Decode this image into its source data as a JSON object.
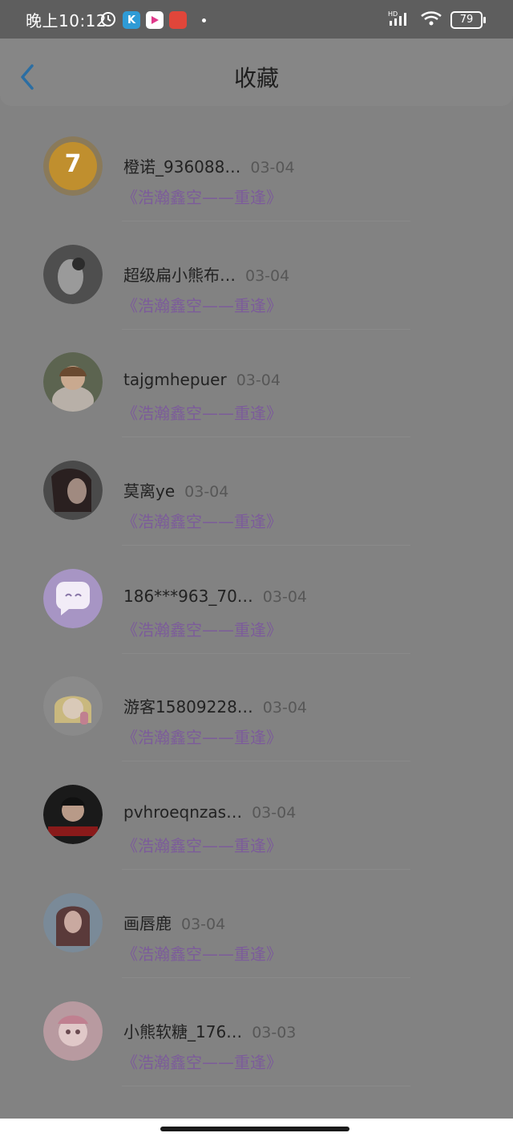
{
  "status_bar": {
    "time": "晚上10:12",
    "battery": "79",
    "network": "HD"
  },
  "header": {
    "title": "收藏"
  },
  "favorites": [
    {
      "name": "橙诺_936088…",
      "date": "03-04",
      "work": "《浩瀚鑫空——重逢》",
      "avatar_color": "#c08f2e"
    },
    {
      "name": "超级扁小熊布…",
      "date": "03-04",
      "work": "《浩瀚鑫空——重逢》",
      "avatar_color": "#4e4e4e"
    },
    {
      "name": "tajgmhepuer",
      "date": "03-04",
      "work": "《浩瀚鑫空——重逢》",
      "avatar_color": "#7a6a5a"
    },
    {
      "name": "莫离ye",
      "date": "03-04",
      "work": "《浩瀚鑫空——重逢》",
      "avatar_color": "#3d3a3a"
    },
    {
      "name": "186***963_70…",
      "date": "03-04",
      "work": "《浩瀚鑫空——重逢》",
      "avatar_color": "#a795c4"
    },
    {
      "name": "游客15809228…",
      "date": "03-04",
      "work": "《浩瀚鑫空——重逢》",
      "avatar_color": "#c9b87e"
    },
    {
      "name": "pvhroeqnzas…",
      "date": "03-04",
      "work": "《浩瀚鑫空——重逢》",
      "avatar_color": "#2b2b2b"
    },
    {
      "name": "画唇鹿",
      "date": "03-04",
      "work": "《浩瀚鑫空——重逢》",
      "avatar_color": "#8a7f8e"
    },
    {
      "name": "小熊软糖_176…",
      "date": "03-03",
      "work": "《浩瀚鑫空——重逢》",
      "avatar_color": "#c9a9b0"
    }
  ]
}
